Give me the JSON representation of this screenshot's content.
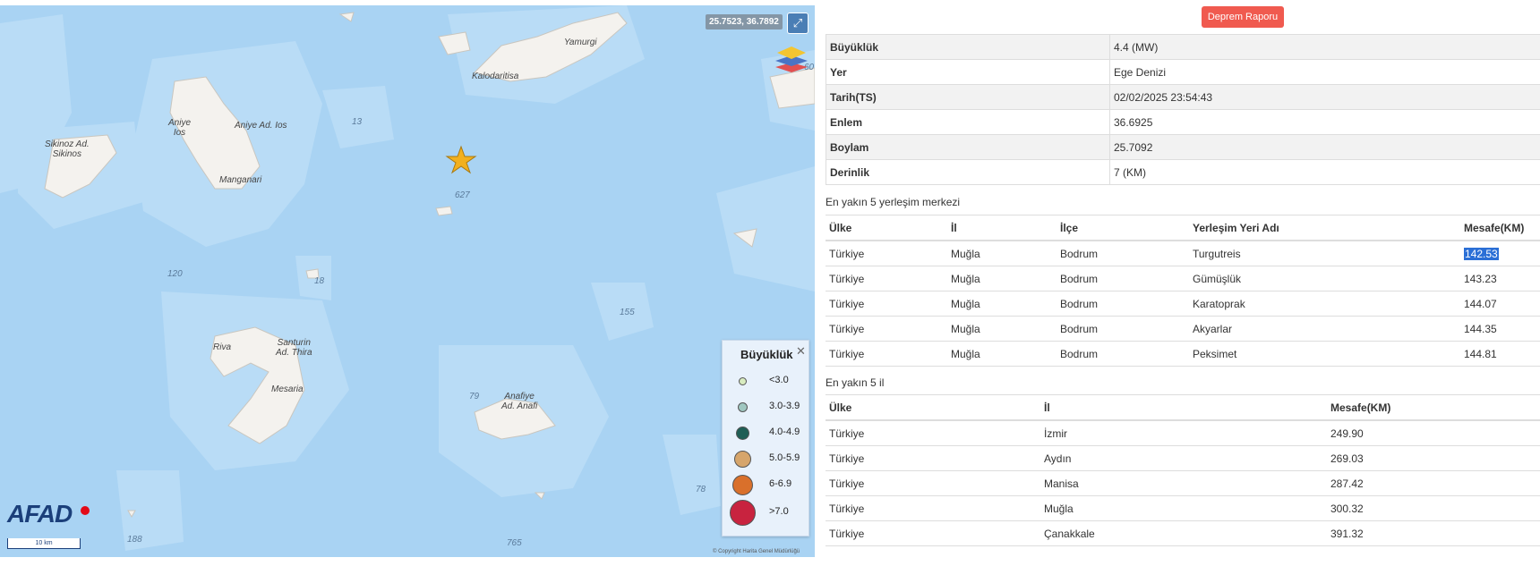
{
  "map": {
    "coordinates": "25.7523, 36.7892",
    "copyright": "© Copyright Harita Genel Müdürlüğü",
    "scale_label": "10 km",
    "logo": "AFAD",
    "icons": {
      "expand": "expand-icon",
      "layers": "layers-icon",
      "epicenter": "star-icon"
    },
    "places": [
      {
        "id": "sikinos",
        "text": "Sikinoz Ad.\nSikinos"
      },
      {
        "id": "aniye",
        "text": "Aniye\nIos"
      },
      {
        "id": "aniye-ad",
        "text": "Aniye Ad. Ios"
      },
      {
        "id": "manganari",
        "text": "Manganari"
      },
      {
        "id": "kalodaritisa",
        "text": "Kalodaritisa"
      },
      {
        "id": "yamurgi",
        "text": "Yamurgi"
      },
      {
        "id": "riva",
        "text": "Riva"
      },
      {
        "id": "santurin",
        "text": "Santurin\nAd. Thira"
      },
      {
        "id": "mesaria",
        "text": "Mesaria"
      },
      {
        "id": "anafiye",
        "text": "Anafiye\nAd. Anafi"
      }
    ],
    "depths": [
      "13",
      "627",
      "120",
      "18",
      "155",
      "79",
      "78",
      "188",
      "765",
      "60"
    ],
    "legend": {
      "title": "Büyüklük",
      "close": "✕",
      "items": [
        {
          "label": "<3.0",
          "color": "#d8ecc0"
        },
        {
          "label": "3.0-3.9",
          "color": "#9fc7c0"
        },
        {
          "label": "4.0-4.9",
          "color": "#1f5e55"
        },
        {
          "label": "5.0-5.9",
          "color": "#d6a56b"
        },
        {
          "label": "6-6.9",
          "color": "#d9702b"
        },
        {
          "label": ">7.0",
          "color": "#c8233f"
        }
      ]
    }
  },
  "report_button": "Deprem Raporu",
  "info": [
    {
      "label": "Büyüklük",
      "value": "4.4 (MW)"
    },
    {
      "label": "Yer",
      "value": "Ege Denizi"
    },
    {
      "label": "Tarih(TS)",
      "value": "02/02/2025 23:54:43"
    },
    {
      "label": "Enlem",
      "value": "36.6925"
    },
    {
      "label": "Boylam",
      "value": "25.7092"
    },
    {
      "label": "Derinlik",
      "value": "7 (KM)"
    }
  ],
  "settlements": {
    "title": "En yakın 5 yerleşim merkezi",
    "headers": [
      "Ülke",
      "İl",
      "İlçe",
      "Yerleşim Yeri Adı",
      "Mesafe(KM)"
    ],
    "rows": [
      [
        "Türkiye",
        "Muğla",
        "Bodrum",
        "Turgutreis",
        "142.53"
      ],
      [
        "Türkiye",
        "Muğla",
        "Bodrum",
        "Gümüşlük",
        "143.23"
      ],
      [
        "Türkiye",
        "Muğla",
        "Bodrum",
        "Karatoprak",
        "144.07"
      ],
      [
        "Türkiye",
        "Muğla",
        "Bodrum",
        "Akyarlar",
        "144.35"
      ],
      [
        "Türkiye",
        "Muğla",
        "Bodrum",
        "Peksimet",
        "144.81"
      ]
    ]
  },
  "provinces": {
    "title": "En yakın 5 il",
    "headers": [
      "Ülke",
      "İl",
      "Mesafe(KM)"
    ],
    "rows": [
      [
        "Türkiye",
        "İzmir",
        "249.90"
      ],
      [
        "Türkiye",
        "Aydın",
        "269.03"
      ],
      [
        "Türkiye",
        "Manisa",
        "287.42"
      ],
      [
        "Türkiye",
        "Muğla",
        "300.32"
      ],
      [
        "Türkiye",
        "Çanakkale",
        "391.32"
      ]
    ]
  }
}
